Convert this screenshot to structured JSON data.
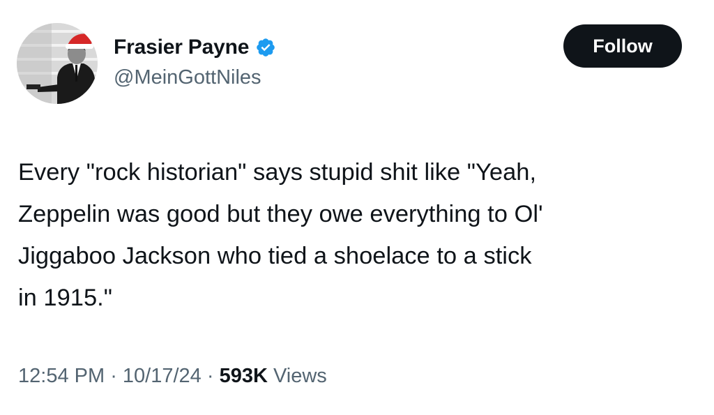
{
  "author": {
    "display_name": "Frasier Payne",
    "handle": "@MeinGottNiles",
    "verified": true,
    "verified_color": "#1d9bf0",
    "avatar_icon": "profile-photo"
  },
  "follow_button": {
    "label": "Follow",
    "background": "#0f1419",
    "text_color": "#ffffff"
  },
  "tweet": {
    "lines": [
      "Every \"rock historian\" says stupid shit like \"Yeah,",
      "Zeppelin was good but they owe everything to Ol'",
      "Jiggaboo Jackson who tied a shoelace to a stick",
      "in 1915.\""
    ]
  },
  "meta": {
    "time": "12:54 PM",
    "separator": " · ",
    "date": "10/17/24",
    "views_count": "593K",
    "views_label": " Views"
  }
}
